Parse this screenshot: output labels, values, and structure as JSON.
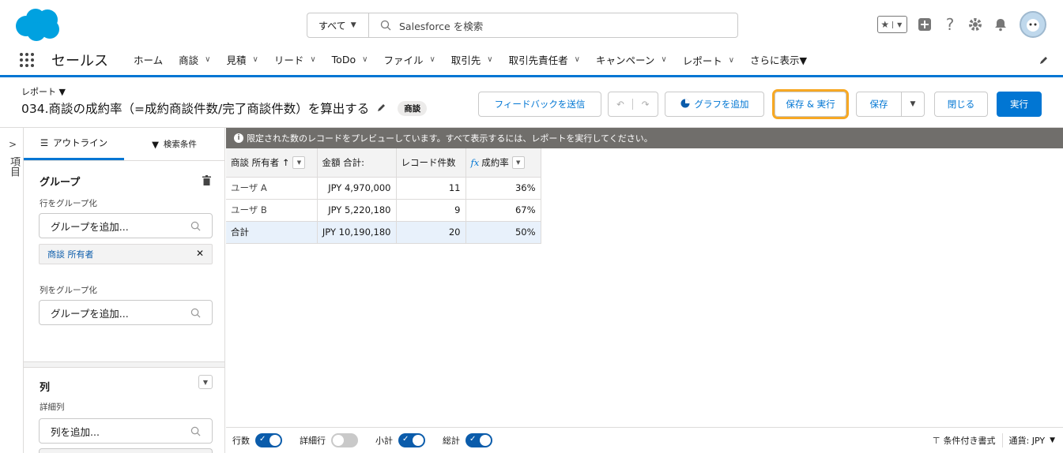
{
  "search": {
    "scope": "すべて",
    "placeholder": "Salesforce を検索"
  },
  "nav": {
    "app_name": "セールス",
    "items": [
      {
        "label": "ホーム",
        "has_menu": false
      },
      {
        "label": "商談",
        "has_menu": true
      },
      {
        "label": "見積",
        "has_menu": true
      },
      {
        "label": "リード",
        "has_menu": true
      },
      {
        "label": "ToDo",
        "has_menu": true
      },
      {
        "label": "ファイル",
        "has_menu": true
      },
      {
        "label": "取引先",
        "has_menu": true
      },
      {
        "label": "取引先責任者",
        "has_menu": true
      },
      {
        "label": "キャンペーン",
        "has_menu": true
      },
      {
        "label": "レポート",
        "has_menu": true,
        "active": true
      },
      {
        "label": "さらに表示▼",
        "has_menu": false
      }
    ]
  },
  "report": {
    "type_label": "レポート ▼",
    "title": "034.商談の成約率（=成約商談件数/完了商談件数）を算出する",
    "object_badge": "商談"
  },
  "toolbar": {
    "feedback": "フィードバックを送信",
    "add_chart": "グラフを追加",
    "save_run": "保存 & 実行",
    "save": "保存",
    "close": "閉じる",
    "run": "実行"
  },
  "rail": {
    "label": "項目"
  },
  "panel": {
    "tab_outline": "アウトライン",
    "tab_filters": "検索条件",
    "groups_title": "グループ",
    "row_group_label": "行をグループ化",
    "add_group_placeholder": "グループを追加...",
    "row_group_chip": "商談 所有者",
    "col_group_label": "列をグループ化",
    "add_col_group_placeholder": "グループを追加...",
    "columns_title": "列",
    "detail_columns_label": "詳細列",
    "add_column_placeholder": "列を追加..."
  },
  "banner": "限定された数のレコードをプレビューしています。すべて表示するには、レポートを実行してください。",
  "table": {
    "headers": [
      "商談 所有者 ↑",
      "金額 合計:",
      "レコード件数",
      "成約率"
    ],
    "rows": [
      [
        "ユーザ A",
        "JPY 4,970,000",
        "11",
        "36%"
      ],
      [
        "ユーザ B",
        "JPY 5,220,180",
        "9",
        "67%"
      ]
    ],
    "total": [
      "合計",
      "JPY 10,190,180",
      "20",
      "50%"
    ]
  },
  "footer": {
    "row_count": "行数",
    "detail_rows": "詳細行",
    "subtotals": "小計",
    "grand_total": "総計",
    "toggles": {
      "row_count": true,
      "detail_rows": false,
      "subtotals": true,
      "grand_total": true
    },
    "conditional_format": "条件付き書式",
    "currency": "通貨: JPY"
  },
  "colors": {
    "brand": "#0176d3",
    "highlight": "#f7a823",
    "banner_bg": "#706e6b"
  }
}
